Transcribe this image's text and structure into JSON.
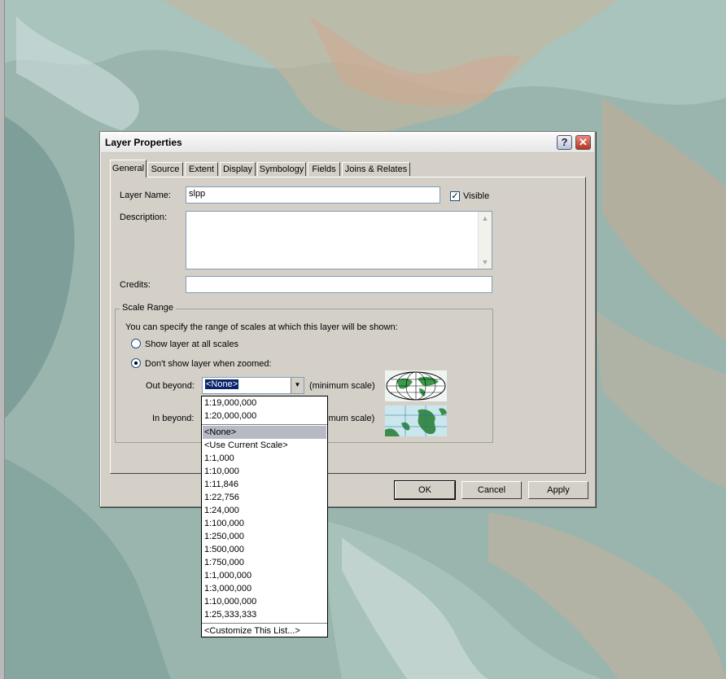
{
  "dialog": {
    "title": "Layer Properties",
    "help_icon": "question-mark-icon",
    "close_icon": "close-x-icon"
  },
  "tabs": [
    {
      "label": "General",
      "active": true
    },
    {
      "label": "Source"
    },
    {
      "label": "Extent"
    },
    {
      "label": "Display"
    },
    {
      "label": "Symbology"
    },
    {
      "label": "Fields"
    },
    {
      "label": "Joins & Relates"
    }
  ],
  "general": {
    "layer_name_label": "Layer Name:",
    "layer_name_value": "slpp",
    "visible_label": "Visible",
    "visible_checked": true,
    "description_label": "Description:",
    "description_value": "",
    "credits_label": "Credits:",
    "credits_value": ""
  },
  "scale_range": {
    "title": "Scale Range",
    "intro": "You can specify the range of scales at which this layer will be shown:",
    "option_all": "Show layer at all scales",
    "option_zoomed": "Don't show layer when zoomed:",
    "selected_option": "option_zoomed",
    "out_beyond_label": "Out beyond:",
    "out_beyond_value": "<None>",
    "min_scale_label": "(minimum scale)",
    "in_beyond_label": "In beyond:",
    "max_scale_label": "imum scale)"
  },
  "buttons": {
    "ok": "OK",
    "cancel": "Cancel",
    "apply": "Apply"
  },
  "dropdown": {
    "top_items": [
      "1:19,000,000",
      "1:20,000,000"
    ],
    "selected": "<None>",
    "items": [
      "<None>",
      "<Use Current Scale>",
      "1:1,000",
      "1:10,000",
      "1:11,846",
      "1:22,756",
      "1:24,000",
      "1:100,000",
      "1:250,000",
      "1:500,000",
      "1:750,000",
      "1:1,000,000",
      "1:3,000,000",
      "1:10,000,000",
      "1:25,333,333"
    ],
    "customize": "<Customize This List...>"
  },
  "colors": {
    "dialog_face": "#d4d0c8",
    "selection": "#0a246a",
    "list_selected": "#b7b9c4"
  }
}
